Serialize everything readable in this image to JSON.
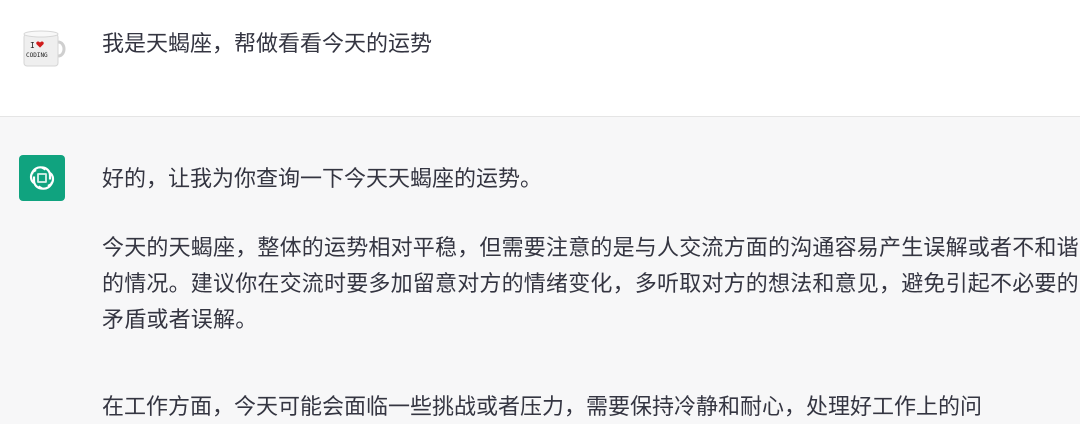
{
  "conversation": {
    "user": {
      "avatar_icon": "coffee-mug-i-love-coding-icon",
      "avatar_text_line1": "I",
      "avatar_text_line2": "CODING",
      "message": "我是天蝎座，帮做看看今天的运势"
    },
    "assistant": {
      "avatar_icon": "openai-logo-icon",
      "accent_color": "#10a37f",
      "message_line1": "好的，让我为你查询一下今天天蝎座的运势。",
      "paragraph1": "今天的天蝎座，整体的运势相对平稳，但需要注意的是与人交流方面的沟通容易产生误解或者不和谐的情况。建议你在交流时要多加留意对方的情绪变化，多听取对方的想法和意见，避免引起不必要的矛盾或者误解。",
      "paragraph2_visible": "在工作方面，今天可能会面临一些挑战或者压力，需要保持冷静和耐心，处理好工作上的问"
    }
  }
}
